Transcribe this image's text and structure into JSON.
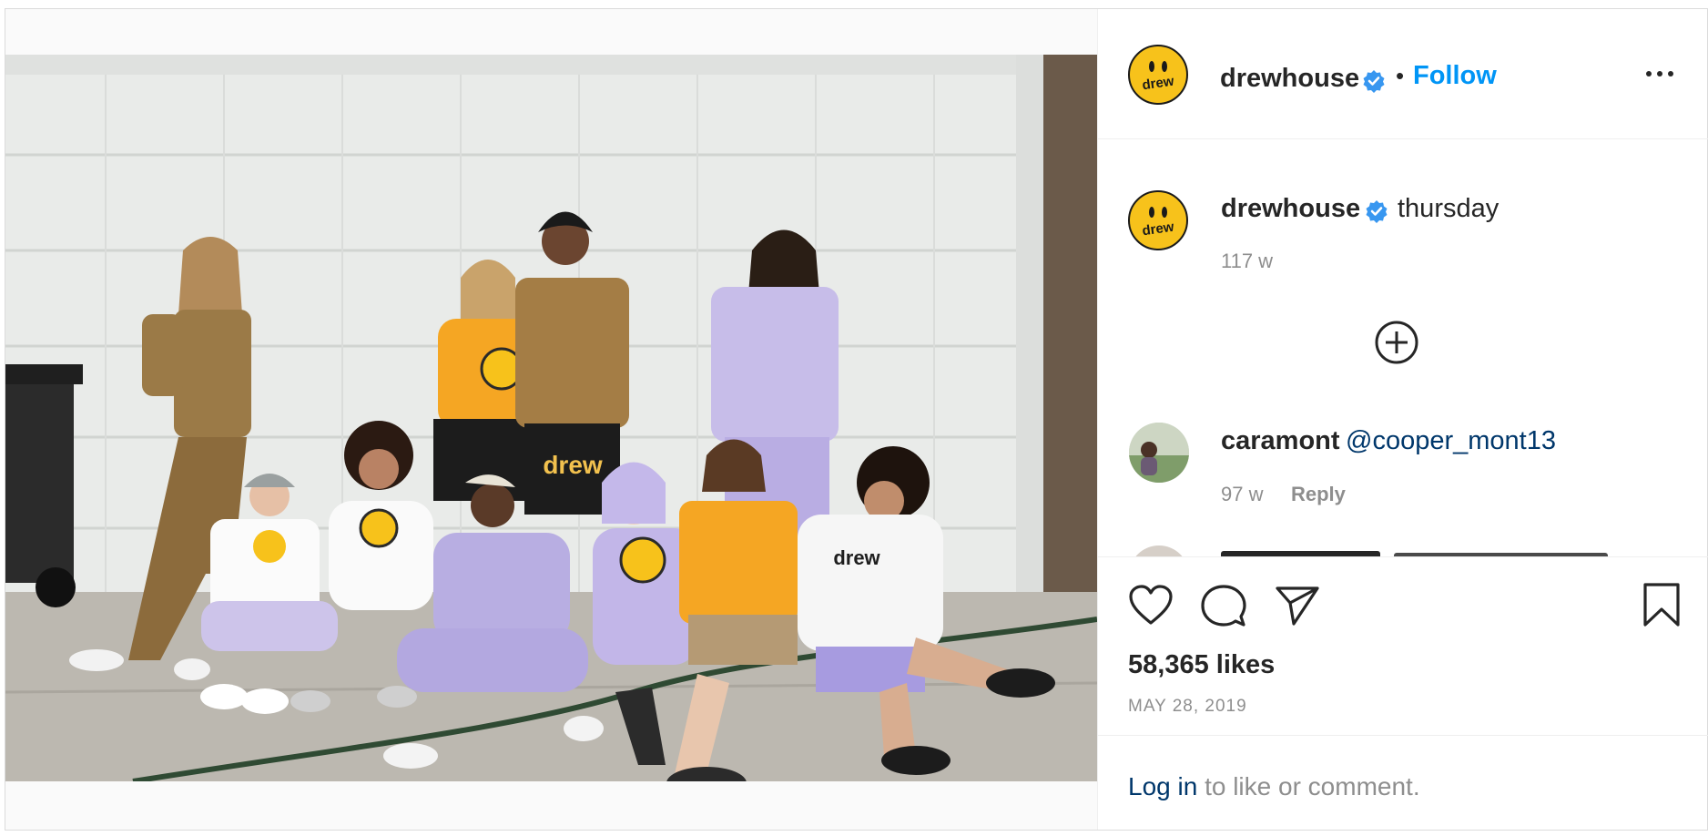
{
  "post": {
    "username": "drewhouse",
    "separator": "•",
    "follow_label": "Follow",
    "avatar_text": "drew"
  },
  "caption": {
    "username": "drewhouse",
    "text": "thursday",
    "time": "117 w"
  },
  "comments": [
    {
      "username": "caramont",
      "text": "@cooper_mont13",
      "time": "97 w",
      "reply_label": "Reply"
    }
  ],
  "stats": {
    "likes": "58,365 likes",
    "date": "MAY 28, 2019"
  },
  "login": {
    "link": "Log in",
    "rest": " to like or comment."
  },
  "photo": {
    "shirt_text": "drew",
    "shorts_text": "drew"
  },
  "colors": {
    "accent_blue": "#0095f6",
    "link_dark_blue": "#00376b",
    "brand_yellow": "#f7c21b",
    "muted_gray": "#8e8e8e",
    "lavender": "#b8aee2",
    "tan": "#9b7a47"
  },
  "icons": {
    "verified": "verified-badge-icon",
    "more": "more-options-icon",
    "load_more": "plus-circle-icon",
    "like": "heart-icon",
    "comment": "comment-bubble-icon",
    "share": "paper-plane-icon",
    "save": "bookmark-icon"
  }
}
